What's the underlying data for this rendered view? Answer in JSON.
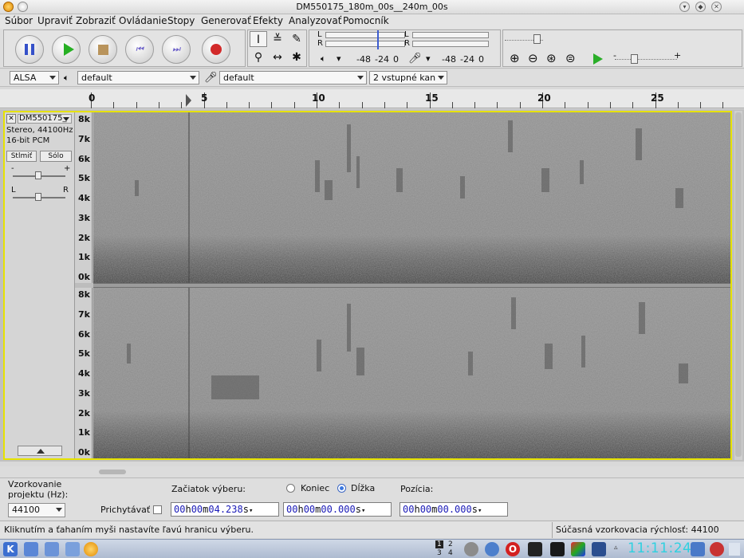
{
  "window": {
    "title": "DM550175_180m_00s__240m_00s"
  },
  "menu": [
    "Súbor",
    "Upraviť",
    "Zobraziť",
    "Ovládanie",
    "Stopy",
    "Generovať",
    "Efekty",
    "Analyzovať",
    "Pomocník"
  ],
  "meters": {
    "play_scale": [
      "-48",
      "-24",
      "0"
    ],
    "rec_scale": [
      "-48",
      "-24",
      "0"
    ],
    "channel_left": "L",
    "channel_right": "R"
  },
  "devices": {
    "host": "ALSA",
    "output": "default",
    "input": "default",
    "channels": "2 vstupné kan"
  },
  "ruler": {
    "labels": [
      "0",
      "5",
      "10",
      "15",
      "20",
      "25"
    ]
  },
  "track": {
    "name": "DM550175_",
    "info_line1": "Stereo, 44100Hz",
    "info_line2": "16-bit PCM",
    "mute_label": "Stlmiť",
    "solo_label": "Sólo",
    "gain_minus": "-",
    "gain_plus": "+",
    "pan_left": "L",
    "pan_right": "R",
    "freq_labels": [
      "8k",
      "7k",
      "6k",
      "5k",
      "4k",
      "3k",
      "2k",
      "1k",
      "0k"
    ]
  },
  "selection": {
    "rate_label_line1": "Vzorkovanie",
    "rate_label_line2": "projektu (Hz):",
    "rate_value": "44100",
    "snap_label": "Prichytávať",
    "start_label": "Začiatok výberu:",
    "end_label": "Koniec",
    "length_label": "Dĺžka",
    "length_selected": true,
    "position_label": "Pozícia:",
    "start_time": {
      "h": "00",
      "m": "00",
      "s": "04.238"
    },
    "length_time": {
      "h": "00",
      "m": "00",
      "s": "00.000"
    },
    "position_time": {
      "h": "00",
      "m": "00",
      "s": "00.000"
    },
    "unit_h": "h",
    "unit_m": "m",
    "unit_s": "s"
  },
  "status": {
    "hint": "Kliknutím a ťahaním myši nastavíte ľavú hranicu výberu.",
    "rate": "Súčasná vzorkovacia rýchlosť: 44100"
  },
  "taskbar": {
    "desktops": [
      "1",
      "2",
      "3",
      "4"
    ],
    "clock": "11:11:24"
  }
}
